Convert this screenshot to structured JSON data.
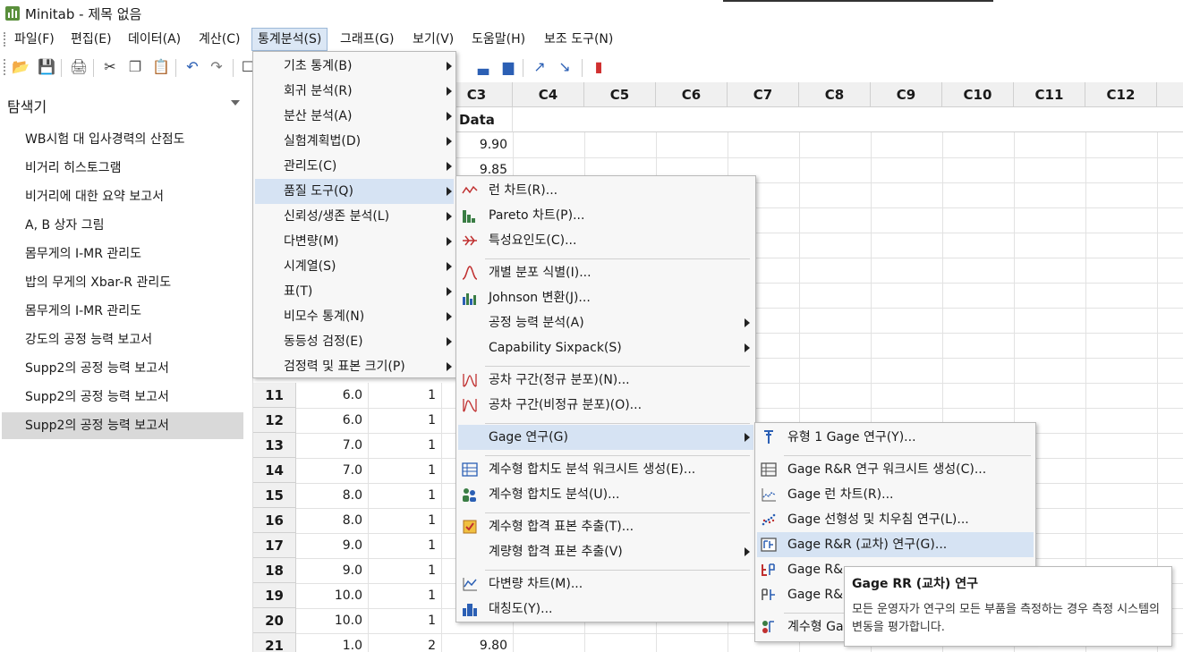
{
  "window": {
    "title": "Minitab - 제목 없음"
  },
  "menubar": [
    "파일(F)",
    "편집(E)",
    "데이터(A)",
    "계산(C)",
    "통계분석(S)",
    "그래프(G)",
    "보기(V)",
    "도움말(H)",
    "보조 도구(N)"
  ],
  "explorer": {
    "title": "탐색기",
    "items": [
      "WB시험 대 입사경력의 산점도",
      "비거리 히스토그램",
      "비거리에 대한 요약 보고서",
      "A, B 상자 그림",
      "몸무게의 I-MR 관리도",
      "밥의 무게의 Xbar-R 관리도",
      "몸무게의 I-MR 관리도",
      "강도의 공정 능력 보고서",
      "Supp2의 공정 능력 보고서",
      "Supp2의 공정 능력 보고서",
      "Supp2의 공정 능력 보고서"
    ]
  },
  "sheet": {
    "columns": [
      "C3",
      "C4",
      "C5",
      "C6",
      "C7",
      "C8",
      "C9",
      "C10",
      "C11",
      "C12"
    ],
    "c3_name": "Data",
    "c3_visible_top": [
      "9.90",
      "9.85"
    ],
    "rows": [
      {
        "n": "11",
        "c1": "6.0",
        "c2": "1"
      },
      {
        "n": "12",
        "c1": "6.0",
        "c2": "1"
      },
      {
        "n": "13",
        "c1": "7.0",
        "c2": "1"
      },
      {
        "n": "14",
        "c1": "7.0",
        "c2": "1"
      },
      {
        "n": "15",
        "c1": "8.0",
        "c2": "1"
      },
      {
        "n": "16",
        "c1": "8.0",
        "c2": "1"
      },
      {
        "n": "17",
        "c1": "9.0",
        "c2": "1"
      },
      {
        "n": "18",
        "c1": "9.0",
        "c2": "1"
      },
      {
        "n": "19",
        "c1": "10.0",
        "c2": "1"
      },
      {
        "n": "20",
        "c1": "10.0",
        "c2": "1"
      },
      {
        "n": "21",
        "c1": "1.0",
        "c2": "2",
        "c3": "9.80"
      }
    ]
  },
  "stat_menu": [
    "기초 통계(B)",
    "회귀 분석(R)",
    "분산 분석(A)",
    "실험계획법(D)",
    "관리도(C)",
    "품질 도구(Q)",
    "신뢰성/생존 분석(L)",
    "다변량(M)",
    "시계열(S)",
    "표(T)",
    "비모수 통계(N)",
    "동등성 검정(E)",
    "검정력 및 표본 크기(P)"
  ],
  "quality_menu": [
    "런 차트(R)...",
    "Pareto 차트(P)...",
    "특성요인도(C)...",
    "개별 분포 식별(I)...",
    "Johnson 변환(J)...",
    "공정 능력 분석(A)",
    "Capability Sixpack(S)",
    "공차 구간(정규 분포)(N)...",
    "공차 구간(비정규 분포)(O)...",
    "Gage 연구(G)",
    "계수형 합치도 분석 워크시트 생성(E)...",
    "계수형 합치도 분석(U)...",
    "계수형 합격 표본 추출(T)...",
    "계량형 합격 표본 추출(V)",
    "다변량 차트(M)...",
    "대칭도(Y)..."
  ],
  "gage_menu": [
    "유형 1 Gage 연구(Y)...",
    "Gage R&R 연구 워크시트 생성(C)...",
    "Gage 런 차트(R)...",
    "Gage 선형성 및 치우침 연구(L)...",
    "Gage R&R (교차) 연구(G)...",
    "Gage R&",
    "Gage R&",
    "계수형 Ga"
  ],
  "tooltip": {
    "title": "Gage RR (교차) 연구",
    "body": "모든 운영자가 연구의 모든 부품을 측정하는 경우 측정 시스템의 변동을 평가합니다."
  },
  "colors": {
    "highlight": "#d6e3f3",
    "selected": "#d9d9d9",
    "menu_bg": "#f7f7f7"
  }
}
